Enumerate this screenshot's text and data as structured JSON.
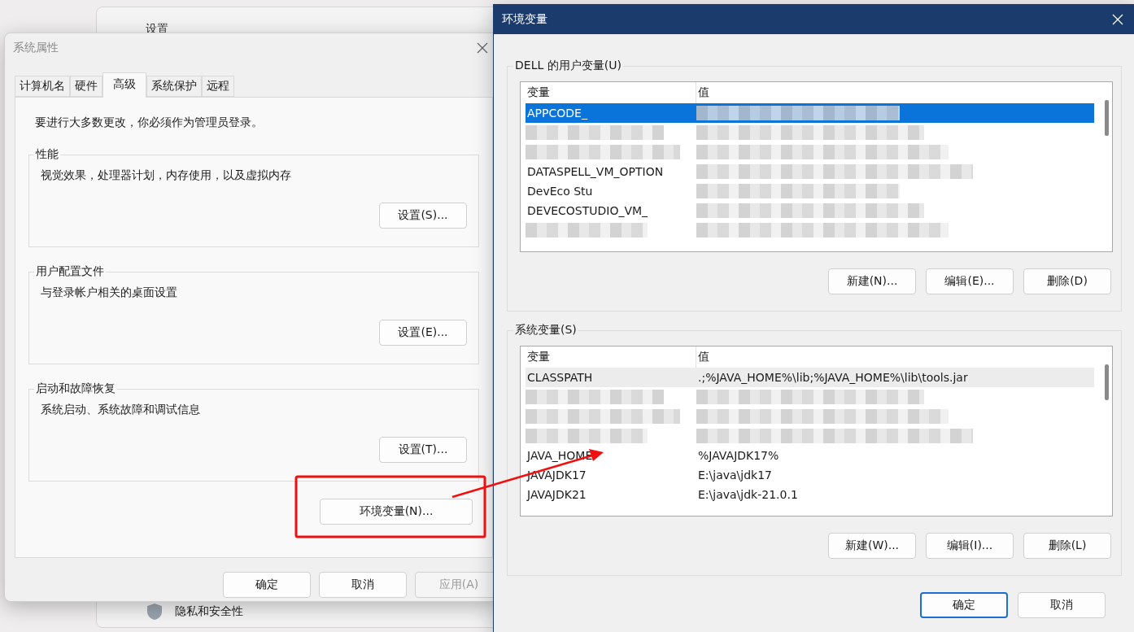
{
  "background_window": {
    "title": "设置",
    "items": [
      {
        "label": "隐私和安全性"
      }
    ]
  },
  "system_properties": {
    "title": "系统属性",
    "tabs": [
      {
        "label": "计算机名",
        "selected": false
      },
      {
        "label": "硬件",
        "selected": false
      },
      {
        "label": "高级",
        "selected": true
      },
      {
        "label": "系统保护",
        "selected": false
      },
      {
        "label": "远程",
        "selected": false
      }
    ],
    "note": "要进行大多数更改，你必须作为管理员登录。",
    "groups": [
      {
        "title": "性能",
        "description": "视觉效果，处理器计划，内存使用，以及虚拟内存",
        "button": "设置(S)..."
      },
      {
        "title": "用户配置文件",
        "description": "与登录帐户相关的桌面设置",
        "button": "设置(E)..."
      },
      {
        "title": "启动和故障恢复",
        "description": "系统启动、系统故障和调试信息",
        "button": "设置(T)..."
      }
    ],
    "env_button": "环境变量(N)...",
    "buttons": [
      {
        "label": "确定",
        "disabled": false
      },
      {
        "label": "取消",
        "disabled": false
      },
      {
        "label": "应用(A)",
        "disabled": true
      }
    ]
  },
  "environment_variables": {
    "title": "环境变量",
    "sections": [
      {
        "title": "DELL 的用户变量(U)",
        "columns": [
          "变量",
          "值"
        ],
        "focused": true,
        "rows": [
          {
            "name": "APPCODE_",
            "selected": true
          },
          {
            "selected": false
          },
          {
            "selected": false
          },
          {
            "name": "DATASPELL_VM_OPTION",
            "selected": false
          },
          {
            "name": "DevEco Stu",
            "selected": false
          },
          {
            "name": "DEVECOSTUDIO_VM_",
            "selected": false
          },
          {
            "selected": false
          }
        ],
        "buttons": [
          "新建(N)...",
          "编辑(E)...",
          "删除(D)"
        ]
      },
      {
        "title": "系统变量(S)",
        "columns": [
          "变量",
          "值"
        ],
        "focused": false,
        "rows": [
          {
            "name": "CLASSPATH",
            "value": ".;%JAVA_HOME%\\lib;%JAVA_HOME%\\lib\\tools.jar",
            "selected": true
          },
          {
            "selected": false
          },
          {
            "selected": false
          },
          {
            "selected": false
          },
          {
            "name": "JAVA_HOME",
            "value": "%JAVAJDK17%",
            "selected": false
          },
          {
            "name": "JAVAJDK17",
            "value": "E:\\java\\jdk17",
            "selected": false
          },
          {
            "name": "JAVAJDK21",
            "value": "E:\\java\\jdk-21.0.1",
            "selected": false
          }
        ],
        "buttons": [
          "新建(W)...",
          "编辑(I)...",
          "删除(L)"
        ]
      }
    ],
    "buttons": [
      {
        "label": "确定",
        "default": true
      },
      {
        "label": "取消",
        "default": false
      }
    ]
  }
}
